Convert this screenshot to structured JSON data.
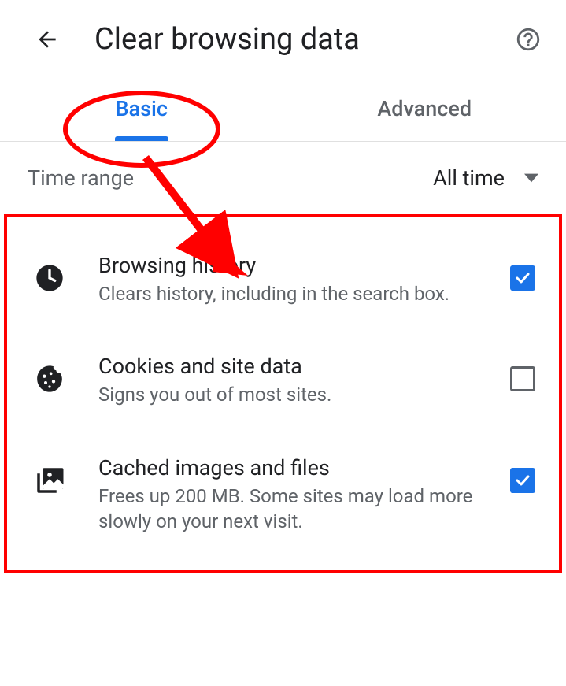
{
  "header": {
    "title": "Clear browsing data"
  },
  "tabs": {
    "basic": "Basic",
    "advanced": "Advanced"
  },
  "timeRange": {
    "label": "Time range",
    "value": "All time"
  },
  "options": [
    {
      "icon": "clock-icon",
      "title": "Browsing history",
      "desc": "Clears history, including in the search box.",
      "checked": true
    },
    {
      "icon": "cookie-icon",
      "title": "Cookies and site data",
      "desc": "Signs you out of most sites.",
      "checked": false
    },
    {
      "icon": "image-stack-icon",
      "title": "Cached images and files",
      "desc": "Frees up 200 MB. Some sites may load more slowly on your next visit.",
      "checked": true
    }
  ]
}
